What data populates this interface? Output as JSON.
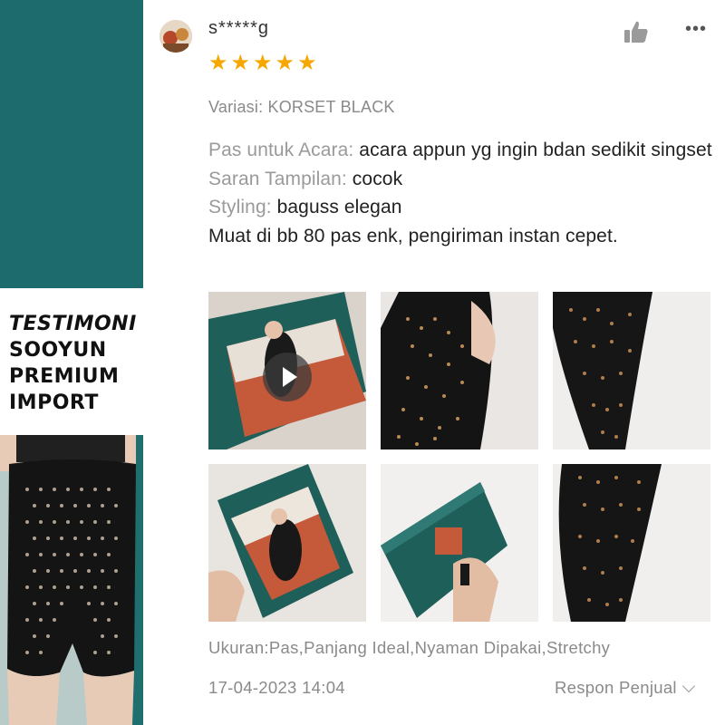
{
  "promo": {
    "line1": "TESTIMONI",
    "line2": "SOOYUN",
    "line3": "PREMIUM",
    "line4": "IMPORT"
  },
  "colors": {
    "teal": "#1d6b6c",
    "star": "#f6a700",
    "muted_text": "#8a8a8a"
  },
  "review": {
    "username": "s*****g",
    "rating": 5,
    "stars": [
      "★",
      "★",
      "★",
      "★",
      "★"
    ],
    "variation": "Variasi: KORSET BLACK",
    "fields": [
      {
        "label": "Pas untuk Acara:",
        "value": " acara appun yg ingin bdan sedikit singset"
      },
      {
        "label": "Saran Tampilan:",
        "value": " cocok"
      },
      {
        "label": "Styling:",
        "value": " baguss elegan"
      }
    ],
    "comment": "Muat di bb 80 pas enk, pengiriman instan cepet.",
    "size_tags": "Ukuran:Pas,Panjang Ideal,Nyaman Dipakai,Stretchy",
    "date": "17-04-2023 14:04",
    "seller_response": "Respon Penjual",
    "icons": {
      "like": "thumbs-up-icon",
      "more": "more-options-icon",
      "play": "play-icon",
      "chevron": "chevron-down-icon"
    }
  }
}
